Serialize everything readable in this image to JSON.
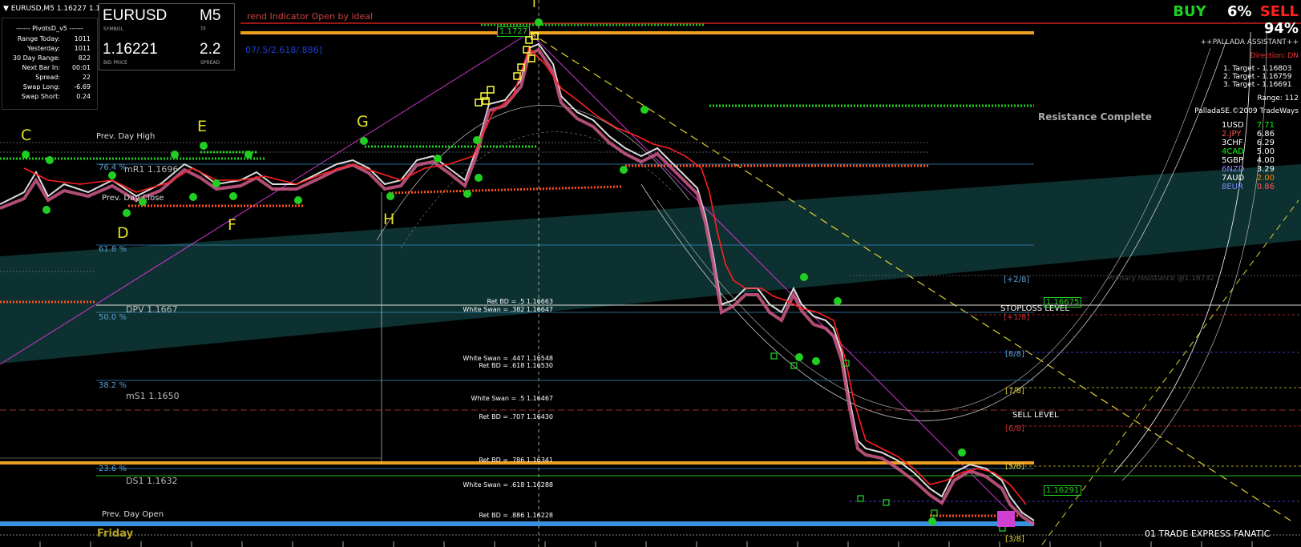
{
  "chart_header": {
    "symbol_line": "EURUSD,M5  1.16227 1.1"
  },
  "indicator_title": "rend Indicator Open by ideal",
  "fib_text": "07/.5/2.618/.886]",
  "pivots": {
    "title": "------  PivotsD_v5  ------",
    "rows": [
      {
        "k": "Range  Today:",
        "v": "1011"
      },
      {
        "k": "Yesterday:",
        "v": "1011"
      },
      {
        "k": "30 Day Range:",
        "v": "822"
      },
      {
        "k": "Next Bar In:",
        "v": "00:01"
      },
      {
        "k": "Spread:",
        "v": "22"
      },
      {
        "k": "Swap  Long:",
        "v": "-6.69"
      },
      {
        "k": "Swap  Short:",
        "v": "0.24"
      }
    ]
  },
  "symbol_box": {
    "symbol": "EURUSD",
    "symbol_cap": "SYMBOL",
    "tf": "M5",
    "tf_cap": "TF",
    "bid": "1.16221",
    "bid_cap": "BID PRICE",
    "spread": "2.2",
    "spread_cap": "SPREAD"
  },
  "assistant": {
    "buy": "BUY",
    "buy_pct": "6%",
    "sell": "SELL",
    "sell_pct": "94%",
    "name": "++PALLADA ASSISTANT++",
    "direction": "Direction: DN",
    "targets": [
      "1. Target - 1.16803",
      "2. Target - 1.16759",
      "3. Target - 1.16691"
    ],
    "range": "Range: 112",
    "copyright": "PalladaSE.©2009 TradeWays"
  },
  "currencies": [
    {
      "name": "1USD",
      "val": "7.71",
      "color": "#ffffff",
      "vcolor": "#00ff00"
    },
    {
      "name": "2.JPY",
      "val": "6.86",
      "color": "#ff5555",
      "vcolor": "#ffffff"
    },
    {
      "name": "3CHF",
      "val": "6.29",
      "color": "#ffffff",
      "vcolor": "#ffffff"
    },
    {
      "name": "4CAD",
      "val": "5.00",
      "color": "#00ff00",
      "vcolor": "#ffffff"
    },
    {
      "name": "5GBP",
      "val": "4.00",
      "color": "#ffffff",
      "vcolor": "#ffffff"
    },
    {
      "name": "6NZD",
      "val": "3.29",
      "color": "#8888ff",
      "vcolor": "#ffffff"
    },
    {
      "name": "7AUD",
      "val": "2.00",
      "color": "#ffffff",
      "vcolor": "#ff8800"
    },
    {
      "name": "8EUR",
      "val": "0.86",
      "color": "#8888ff",
      "vcolor": "#ff5555"
    }
  ],
  "waves": {
    "C": "C",
    "D": "D",
    "E": "E",
    "F": "F",
    "G": "G",
    "H": "H",
    "I": "I"
  },
  "levels": {
    "prev_day_high": "Prev. Day High",
    "prev_day_close": "Prev. Day Close",
    "prev_day_open": "Prev. Day Open",
    "friday": "Friday",
    "fib_76": "76.4 %",
    "mr1": "mR1   1.1696",
    "fib_618": "61.8 %",
    "dpv": "DPV   1.1667",
    "fib_50": "50.0 %",
    "fib_382": "38.2 %",
    "ms1": "mS1   1.1650",
    "fib_236": "23.6 %",
    "ds1": "DS1   1.1632",
    "resistance": "Resistance Complete",
    "stoploss": "STOPLOSS LEVEL",
    "sell_level": "SELL LEVEL",
    "trade_express": "01 TRADE EXPRESS FANATIC",
    "primary": "Primary resistance @1.16732",
    "price_tag_1": "1.16675",
    "price_tag_2": "1.16291",
    "price_tag_3": "1.1727",
    "m_28": "[+2/8]",
    "m_18": "[+1/8]",
    "m_88": "[8/8]",
    "m_78": "[7/8]",
    "m_68": "[6/8]",
    "m_58": "[5/8]",
    "m_38": "[3/8]"
  },
  "swans": [
    "Ret BD = .5   1.16663",
    "White Swan = .382  1.16647",
    "White Swan = .447  1.16548",
    "Ret BD = .618  1.16530",
    "White Swan = .5  1.16467",
    "Ret BD = .707  1.16430",
    "Ret BD = .786  1.16341",
    "White Swan = .618  1.16288",
    "Ret BD = .886  1.16228"
  ]
}
